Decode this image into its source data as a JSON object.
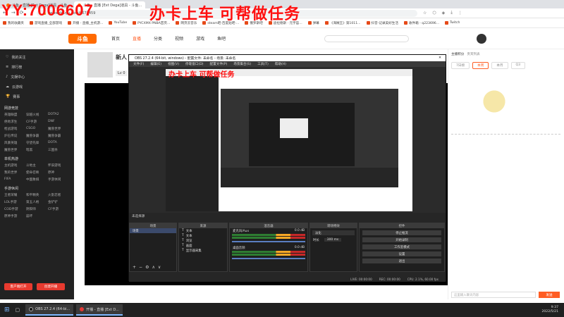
{
  "browser": {
    "tabs": [
      {
        "label": "斗鱼 - 直播 [Ext Dega]道具 - 斗鱼..."
      },
      {
        "label": "斗鱼 - 直播 [Ext Dega]道具 - 斗鱼..."
      }
    ],
    "url": "www.douyu.com/6671459",
    "bookmarks": [
      "我的收藏夹",
      "游戏直播_全部游戏",
      "开播 - 直播_主机游...",
      "YouTube",
      "PYCXMX PNBA首页...",
      "网页云音乐",
      "steam吧-百度贴吧-...",
      "俄罗斯吧",
      "迪拉德斯 · 元宇宙...",
      "弹幕",
      "《海贼王》第1011...",
      "抖音-记录美好生活",
      "收件箱 - q223696...",
      "Twitch"
    ]
  },
  "overlay": {
    "left": "YY:7006607",
    "right": "办卡上车   可帮做任务"
  },
  "site": {
    "logo": "斗鱼",
    "nav": [
      "首页",
      "直播",
      "分类",
      "视频",
      "游戏",
      "鱼吧"
    ],
    "room_title": "新人",
    "room_meta": "Lv 0"
  },
  "sidebar": {
    "top": [
      "我的关注",
      "排行榜",
      "文娱中心",
      "云游戏"
    ],
    "icons": [
      "赛事",
      "",
      "",
      "",
      "",
      ""
    ],
    "cat1": "网游竞技",
    "cat1_items": [
      "英雄联盟",
      "穿越火线",
      "DOTA2",
      "绝地求生",
      "CF手游",
      "DNF",
      "枪战游戏",
      "CSGO",
      "魔兽世界",
      "炉石传说",
      "魔兽争霸",
      "魔兽争霸",
      "风暴英雄",
      "守望先锋",
      "DOTA",
      "魔兽世界",
      "暗黑",
      "三国杀"
    ],
    "cat2": "单机热游",
    "cat2_items": [
      "主机游戏",
      "斗地主",
      "怀旧游戏",
      "我的世界",
      "使命召唤",
      "原神",
      "FIFA",
      "中国象棋",
      "手游休闲"
    ],
    "cat3": "手游休闲",
    "cat3_items": [
      "王者荣耀",
      "和平精英",
      "火影忍者",
      "LOL手游",
      "第五人格",
      "金铲铲",
      "COD手游",
      "阴阳师",
      "CF手游",
      "原神手游",
      "崩坏"
    ],
    "btn_left": "客户端打开",
    "btn_right": "创建开播"
  },
  "obs": {
    "title": "OBS 27.2.4 (64-bit, windows) - 配置文件: 未命名 - 场景: 未命名",
    "menu": [
      "文件(F)",
      "编辑(E)",
      "视图(V)",
      "停靠窗口(D)",
      "配置文件(P)",
      "场景集合(S)",
      "工具(T)",
      "帮助(H)"
    ],
    "scene_label": "未选择源",
    "dock_titles": [
      "场景",
      "来源",
      "混音器",
      "转场特效",
      "控件"
    ],
    "scenes": [
      "场景"
    ],
    "sources": [
      "文本",
      "文本",
      "浏览",
      "画面",
      "显示器采集"
    ],
    "mixer": [
      {
        "name": "麦克风/Aux",
        "db": "0.0 dB"
      },
      {
        "name": "桌面音频",
        "db": "0.0 dB"
      }
    ],
    "transition": {
      "type": "淡化",
      "duration_label": "时长",
      "duration": "300 ms"
    },
    "controls": [
      "停止推流",
      "开始录制",
      "工作室模式",
      "设置",
      "退出"
    ],
    "status": [
      "LIVE: 00:00:00",
      "REC: 00:00:00",
      "CPU: 2.1%, 60.00 fps"
    ]
  },
  "chat": {
    "tabs": [
      "主播积分",
      "贵宾列表"
    ],
    "subtabs": [
      "7日榜",
      "本周",
      "本月",
      "Q3"
    ],
    "input_placeholder": "这里输入聊天内容",
    "send": "发送"
  },
  "taskbar": {
    "items": [
      "OBS 27.2.4 (64-bi...",
      "开播 - 直播 [Ext D..."
    ],
    "time": "9:37",
    "date": "2022/5/21"
  }
}
